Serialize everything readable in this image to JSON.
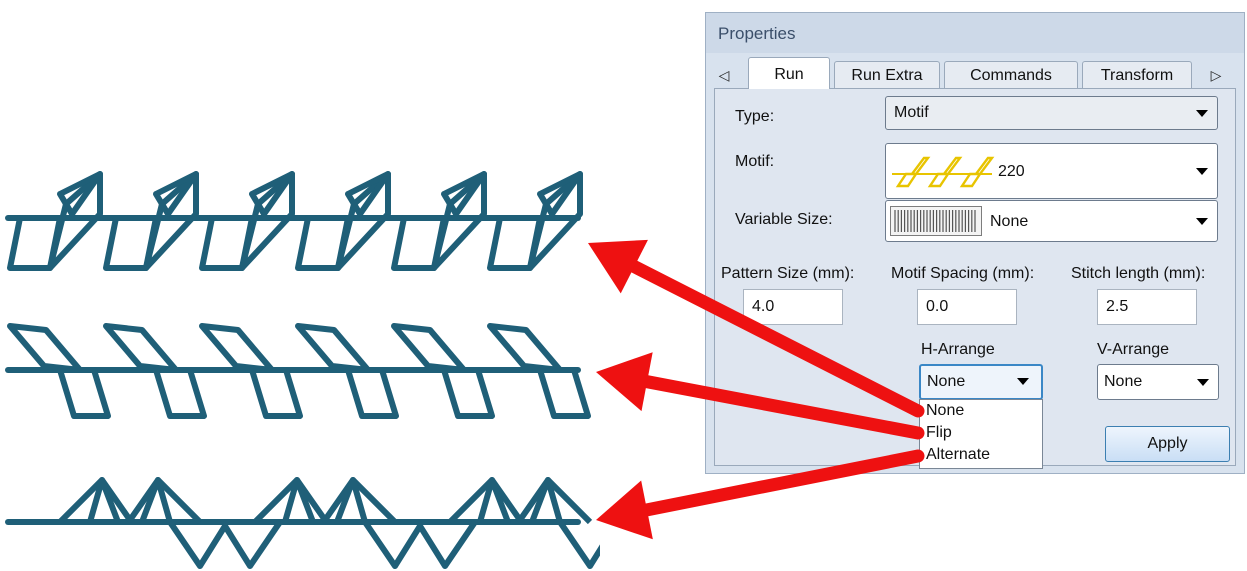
{
  "panel": {
    "title": "Properties",
    "tabs": [
      "Run",
      "Run Extra",
      "Commands",
      "Transform"
    ],
    "active_tab": "Run",
    "type_label": "Type:",
    "type_value": "Motif",
    "motif_label": "Motif:",
    "motif_value": "220",
    "variable_size_label": "Variable Size:",
    "variable_size_value": "None",
    "pattern_size_label": "Pattern Size (mm):",
    "pattern_size_value": "4.0",
    "motif_spacing_label": "Motif Spacing (mm):",
    "motif_spacing_value": "0.0",
    "stitch_length_label": "Stitch length (mm):",
    "stitch_length_value": "2.5",
    "h_arrange_label": "H-Arrange",
    "h_arrange_value": "None",
    "v_arrange_label": "V-Arrange",
    "v_arrange_value": "None",
    "h_arrange_options": [
      "None",
      "Flip",
      "Alternate"
    ],
    "apply_label": "Apply"
  },
  "colors": {
    "stitch": "#1f5f78",
    "arrow": "#ee1111",
    "motif_icon": "#e8c400",
    "panel_bg": "#d8e2ee"
  },
  "icons": {
    "tab_left": "triangle-left-icon",
    "tab_right": "triangle-right-icon"
  }
}
